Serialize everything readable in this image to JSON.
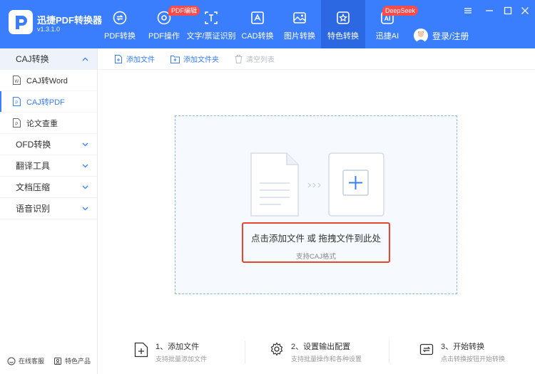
{
  "app": {
    "name": "迅捷PDF转换器",
    "version": "v1.3.1.0"
  },
  "nav": [
    {
      "label": "PDF转换",
      "icon": "pdf-convert-icon"
    },
    {
      "label": "PDF操作",
      "icon": "pdf-operate-icon",
      "badge": "PDF编辑"
    },
    {
      "label": "文字/票证识别",
      "icon": "text-ocr-icon"
    },
    {
      "label": "CAD转换",
      "icon": "cad-icon"
    },
    {
      "label": "图片转换",
      "icon": "image-icon"
    },
    {
      "label": "特色转换",
      "icon": "feature-icon",
      "active": true
    },
    {
      "label": "迅捷AI",
      "icon": "ai-icon",
      "badge": "DeepSeek"
    }
  ],
  "user": {
    "label": "登录/注册"
  },
  "sidebar": {
    "groups": [
      {
        "label": "CAJ转换",
        "open": true,
        "items": [
          {
            "label": "CAJ转Word",
            "icon": "word-doc-icon"
          },
          {
            "label": "CAJ转PDF",
            "icon": "pdf-doc-icon",
            "active": true
          },
          {
            "label": "论文查重",
            "icon": "paper-check-icon"
          }
        ]
      },
      {
        "label": "OFD转换"
      },
      {
        "label": "翻译工具"
      },
      {
        "label": "文档压缩"
      },
      {
        "label": "语音识别"
      }
    ],
    "footer": {
      "service": "在线客服",
      "products": "特色产品"
    }
  },
  "toolbar": {
    "add_file": "添加文件",
    "add_folder": "添加文件夹",
    "clear_list": "清空列表"
  },
  "dropzone": {
    "main": "点击添加文件 或 拖拽文件到此处",
    "sub": "支持CAJ格式"
  },
  "steps": [
    {
      "title": "1、添加文件",
      "desc": "支持批量添加文件"
    },
    {
      "title": "2、设置输出配置",
      "desc": "支持批量操作和各种设置"
    },
    {
      "title": "3、开始转换",
      "desc": "点击转换按钮开始转换"
    }
  ],
  "colors": {
    "brand": "#3a7dfd",
    "highlight": "#e8452c",
    "badge": "#ff4b4b"
  }
}
